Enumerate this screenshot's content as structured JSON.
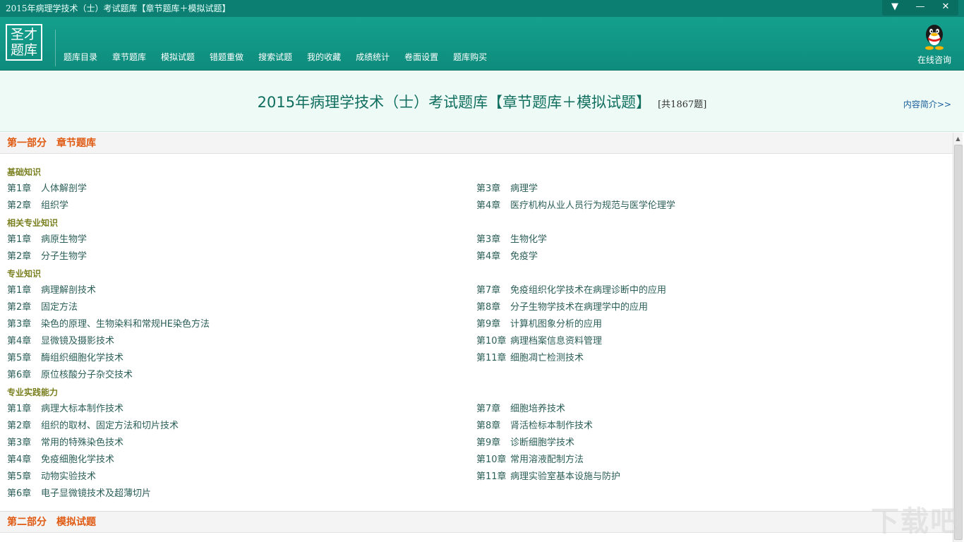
{
  "window": {
    "title": "2015年病理学技术（士）考试题库【章节题库＋模拟试题】",
    "controls": {
      "menu": "▼",
      "minimize": "—",
      "close": "✕"
    }
  },
  "header": {
    "logo_line1": "圣才",
    "logo_line2": "题库",
    "menu": [
      "题库目录",
      "章节题库",
      "模拟试题",
      "错题重做",
      "搜索试题",
      "我的收藏",
      "成绩统计",
      "卷面设置",
      "题库购买"
    ],
    "consult_label": "在线咨询"
  },
  "banner": {
    "title": "2015年病理学技术（士）考试题库【章节题库＋模拟试题】",
    "count": "[共1867题]",
    "intro_link": "内容简介>>"
  },
  "part1": {
    "label": "第一部分",
    "name": "章节题库",
    "sections": [
      {
        "title": "基础知识",
        "left": [
          {
            "num": "第1章",
            "name": "人体解剖学"
          },
          {
            "num": "第2章",
            "name": "组织学"
          }
        ],
        "right": [
          {
            "num": "第3章",
            "name": "病理学"
          },
          {
            "num": "第4章",
            "name": "医疗机构从业人员行为规范与医学伦理学"
          }
        ]
      },
      {
        "title": "相关专业知识",
        "left": [
          {
            "num": "第1章",
            "name": "病原生物学"
          },
          {
            "num": "第2章",
            "name": "分子生物学"
          }
        ],
        "right": [
          {
            "num": "第3章",
            "name": "生物化学"
          },
          {
            "num": "第4章",
            "name": "免疫学"
          }
        ]
      },
      {
        "title": "专业知识",
        "left": [
          {
            "num": "第1章",
            "name": "病理解剖技术"
          },
          {
            "num": "第2章",
            "name": "固定方法"
          },
          {
            "num": "第3章",
            "name": "染色的原理、生物染料和常规HE染色方法"
          },
          {
            "num": "第4章",
            "name": "显微镜及摄影技术"
          },
          {
            "num": "第5章",
            "name": "酶组织细胞化学技术"
          },
          {
            "num": "第6章",
            "name": "原位核酸分子杂交技术"
          }
        ],
        "right": [
          {
            "num": "第7章",
            "name": "免疫组织化学技术在病理诊断中的应用"
          },
          {
            "num": "第8章",
            "name": "分子生物学技术在病理学中的应用"
          },
          {
            "num": "第9章",
            "name": "计算机图象分析的应用"
          },
          {
            "num": "第10章",
            "name": "病理档案信息资料管理"
          },
          {
            "num": "第11章",
            "name": "细胞凋亡检测技术"
          }
        ]
      },
      {
        "title": "专业实践能力",
        "left": [
          {
            "num": "第1章",
            "name": "病理大标本制作技术"
          },
          {
            "num": "第2章",
            "name": "组织的取材、固定方法和切片技术"
          },
          {
            "num": "第3章",
            "name": "常用的特殊染色技术"
          },
          {
            "num": "第4章",
            "name": "免疫细胞化学技术"
          },
          {
            "num": "第5章",
            "name": "动物实验技术"
          },
          {
            "num": "第6章",
            "name": "电子显微镜技术及超薄切片"
          }
        ],
        "right": [
          {
            "num": "第7章",
            "name": "细胞培养技术"
          },
          {
            "num": "第8章",
            "name": "肾活检标本制作技术"
          },
          {
            "num": "第9章",
            "name": "诊断细胞学技术"
          },
          {
            "num": "第10章",
            "name": "常用溶液配制方法"
          },
          {
            "num": "第11章",
            "name": "病理实验室基本设施与防护"
          }
        ]
      }
    ]
  },
  "part2": {
    "label": "第二部分",
    "name": "模拟试题"
  },
  "watermark": "下载吧"
}
